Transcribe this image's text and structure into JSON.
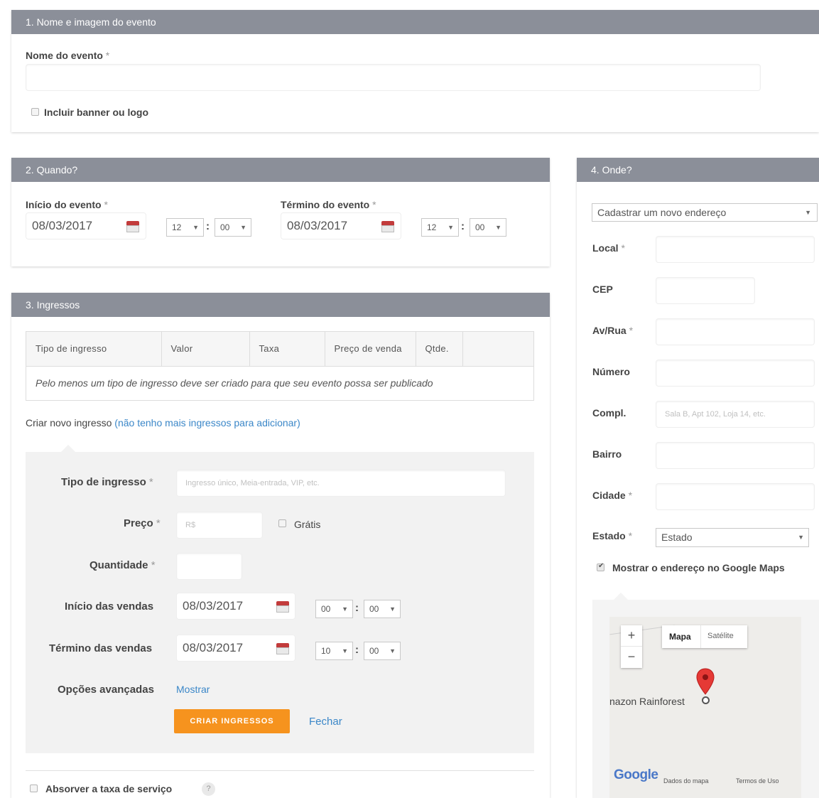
{
  "section1": {
    "header": "1. Nome e imagem do evento",
    "event_name_label": "Nome do evento",
    "required_mark": "*",
    "banner_checkbox_label": "Incluir banner ou logo"
  },
  "section2": {
    "header": "2. Quando?",
    "start_label": "Início do evento",
    "end_label": "Término do evento",
    "start_date": "08/03/2017",
    "start_hour": "12",
    "start_minute": "00",
    "end_date": "08/03/2017",
    "end_hour": "12",
    "end_minute": "00"
  },
  "section3": {
    "header": "3. Ingressos",
    "table_headers": [
      "Tipo de ingresso",
      "Valor",
      "Taxa",
      "Preço de venda",
      "Qtde."
    ],
    "empty_message": "Pelo menos um tipo de ingresso deve ser criado para que seu evento possa ser publicado",
    "create_new_label": "Criar novo ingresso",
    "no_more_link": "(não tenho mais ingressos para adicionar)",
    "form": {
      "ticket_type_label": "Tipo de ingresso",
      "ticket_type_placeholder": "Ingresso único, Meia-entrada, VIP, etc.",
      "price_label": "Preço",
      "price_placeholder": "R$",
      "free_label": "Grátis",
      "quantity_label": "Quantidade",
      "sales_start_label": "Início das vendas",
      "sales_start_date": "08/03/2017",
      "sales_start_hour": "00",
      "sales_start_minute": "00",
      "sales_end_label": "Término das vendas",
      "sales_end_date": "08/03/2017",
      "sales_end_hour": "10",
      "sales_end_minute": "00",
      "advanced_label": "Opções avançadas",
      "advanced_link": "Mostrar",
      "create_button": "CRIAR INGRESSOS",
      "close_link": "Fechar"
    },
    "absorb_fee_label": "Absorver a taxa de serviço",
    "help_icon": "?"
  },
  "section4": {
    "header": "4. Onde?",
    "address_select": "Cadastrar um novo endereço",
    "local_label": "Local",
    "cep_label": "CEP",
    "street_label": "Av/Rua",
    "number_label": "Número",
    "compl_label": "Compl.",
    "compl_placeholder": "Sala B, Apt 102, Loja 14, etc.",
    "neighborhood_label": "Bairro",
    "city_label": "Cidade",
    "state_label": "Estado",
    "state_select": "Estado",
    "show_map_label": "Mostrar o endereço no Google Maps",
    "map": {
      "zoom_in": "+",
      "zoom_out": "−",
      "tab_map": "Mapa",
      "tab_satellite": "Satélite",
      "place_label": "nazon Rainforest",
      "logo": "Google",
      "map_data": "Dados do mapa",
      "terms": "Termos de Uso"
    }
  },
  "colors": {
    "header_bg": "#8b8f99",
    "accent_orange": "#f6931e",
    "link_blue": "#3b87c8",
    "pin_red": "#e53935"
  }
}
